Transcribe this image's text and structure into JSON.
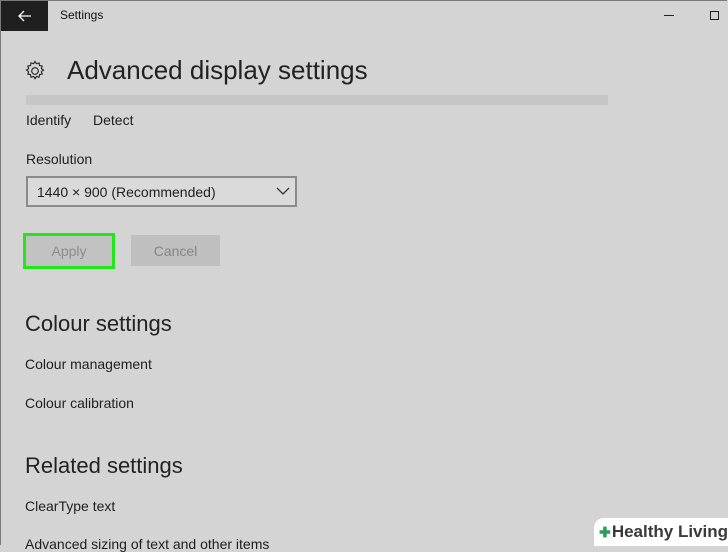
{
  "window": {
    "title": "Settings"
  },
  "page": {
    "title": "Advanced display settings"
  },
  "display": {
    "identify_label": "Identify",
    "detect_label": "Detect",
    "resolution_label": "Resolution",
    "resolution_value": "1440 × 900 (Recommended)",
    "apply_label": "Apply",
    "cancel_label": "Cancel"
  },
  "colour_settings": {
    "heading": "Colour settings",
    "items": [
      "Colour management",
      "Colour calibration"
    ]
  },
  "related_settings": {
    "heading": "Related settings",
    "items": [
      "ClearType text",
      "Advanced sizing of text and other items"
    ]
  },
  "watermark": {
    "text": "Healthy Living"
  },
  "colors": {
    "background": "#d4d4d4",
    "back_button": "#1f1f1f",
    "apply_highlight": "#22e81a",
    "logo_green": "#2e9d57"
  },
  "icons": [
    "back-arrow-icon",
    "gear-icon",
    "chevron-down-icon",
    "minimize-icon",
    "maximize-icon"
  ]
}
